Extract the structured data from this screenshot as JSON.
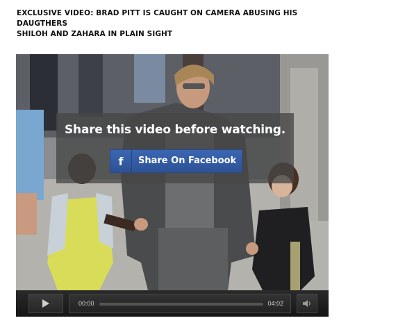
{
  "article": {
    "headline_line1": "EXCLUSIVE VIDEO: BRAD PITT IS CAUGHT ON CAMERA ABUSING HIS DAUGTHERS",
    "headline_line2": "SHILOH AND ZAHARA IN PLAIN SIGHT"
  },
  "player": {
    "overlay_title": "Share this video before watching.",
    "share_button_label": "Share On Facebook",
    "share_icon": "facebook-icon",
    "share_icon_glyph": "f",
    "current_time": "00:00",
    "total_time": "04:02",
    "progress": 0,
    "play_icon": "play-icon",
    "volume_icon": "speaker-icon"
  },
  "colors": {
    "facebook_blue": "#3b5998",
    "overlay_bg": "#464646",
    "controls_bg": "#1e1e1e"
  }
}
